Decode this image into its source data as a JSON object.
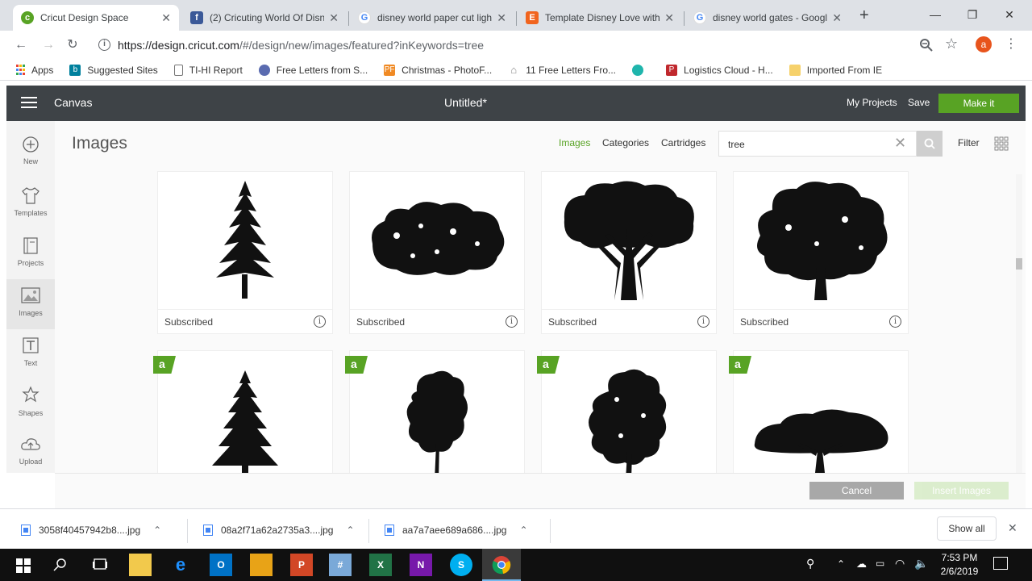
{
  "browser": {
    "tabs": [
      {
        "title": "Cricut Design Space",
        "icon": "cricut-favicon",
        "color": "#58a324",
        "active": true
      },
      {
        "title": "(2) Cricuting World Of Disne",
        "icon": "facebook-favicon",
        "color": "#3b5998",
        "active": false
      },
      {
        "title": "disney world paper cut ligh",
        "icon": "google-favicon",
        "color": "#4285f4",
        "active": false
      },
      {
        "title": "Template Disney Love with",
        "icon": "etsy-favicon",
        "color": "#f1641e",
        "active": false
      },
      {
        "title": "disney world gates - Googl",
        "icon": "google-favicon",
        "color": "#4285f4",
        "active": false
      }
    ],
    "url_host": "https://design.cricut.com",
    "url_path": "/#/design/new/images/featured?inKeywords=tree",
    "profile_initial": "a",
    "bookmarks": [
      {
        "label": "Apps",
        "icon": "apps-grid-icon"
      },
      {
        "label": "Suggested Sites",
        "icon": "bing-icon"
      },
      {
        "label": "TI-HI Report",
        "icon": "page-icon"
      },
      {
        "label": "Free Letters from S...",
        "icon": "globe-icon"
      },
      {
        "label": "Christmas - PhotoF...",
        "icon": "photofunia-icon"
      },
      {
        "label": "11 Free Letters Fro...",
        "icon": "house-icon"
      },
      {
        "label": "",
        "icon": "cloud-icon"
      },
      {
        "label": "Logistics Cloud - H...",
        "icon": "pdf-icon"
      },
      {
        "label": "Imported From IE",
        "icon": "folder-icon"
      }
    ]
  },
  "cricut": {
    "app_name": "Canvas",
    "doc_title": "Untitled*",
    "my_projects": "My Projects",
    "save": "Save",
    "make_it": "Make it",
    "accent": "#58a324",
    "header_bg": "#3e4347",
    "sidebar": [
      {
        "label": "New",
        "icon": "plus-circle-icon"
      },
      {
        "label": "Templates",
        "icon": "tshirt-icon"
      },
      {
        "label": "Projects",
        "icon": "book-icon"
      },
      {
        "label": "Images",
        "icon": "image-icon",
        "active": true
      },
      {
        "label": "Text",
        "icon": "text-icon"
      },
      {
        "label": "Shapes",
        "icon": "shapes-icon"
      },
      {
        "label": "Upload",
        "icon": "upload-icon"
      }
    ],
    "page_title": "Images",
    "filters": {
      "images": "Images",
      "categories": "Categories",
      "cartridges": "Cartridges",
      "filter": "Filter"
    },
    "search_value": "tree",
    "cards_row1": [
      {
        "status": "Subscribed",
        "art": "pine-tree"
      },
      {
        "status": "Subscribed",
        "art": "bush-tree"
      },
      {
        "status": "Subscribed",
        "art": "branching-tree"
      },
      {
        "status": "Subscribed",
        "art": "oak-tree"
      }
    ],
    "cards_row2": [
      {
        "badge": "a",
        "art": "spruce-tree"
      },
      {
        "badge": "a",
        "art": "slim-tree"
      },
      {
        "badge": "a",
        "art": "dense-tree"
      },
      {
        "badge": "a",
        "art": "acacia-tree"
      }
    ],
    "cancel": "Cancel",
    "insert_images": "Insert Images"
  },
  "downloads": {
    "files": [
      "3058f40457942b8....jpg",
      "08a2f71a62a2735a3....jpg",
      "aa7a7aee689a686....jpg"
    ],
    "show_all": "Show all"
  },
  "taskbar": {
    "time": "7:53 PM",
    "date": "2/6/2019"
  }
}
